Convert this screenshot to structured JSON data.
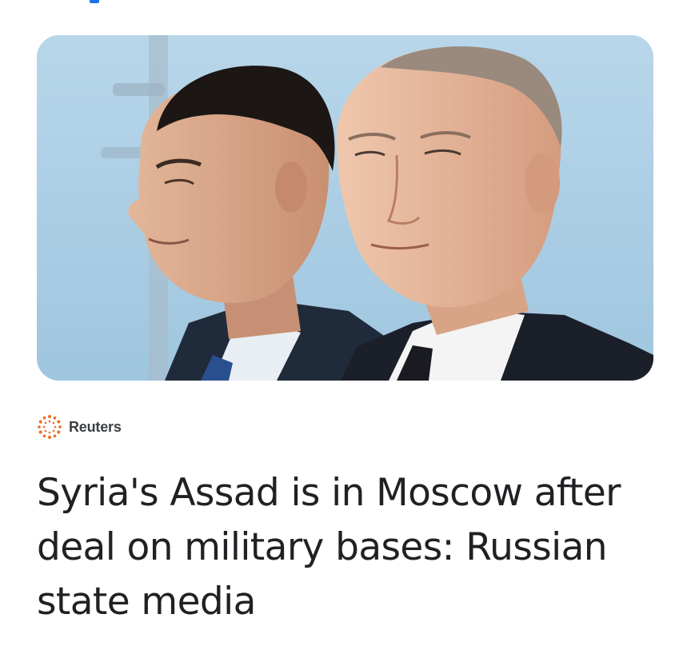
{
  "article": {
    "image_alt": "Bashar al-Assad and Vladimir Putin",
    "source": {
      "name": "Reuters",
      "logo_icon": "reuters-logo-icon",
      "logo_color": "#f26b21"
    },
    "headline": "Syria's Assad is in Moscow after deal on military bases: Russian state media"
  },
  "colors": {
    "accent": "#1a73e8",
    "headline_text": "#202124",
    "source_text": "#3c4043"
  }
}
